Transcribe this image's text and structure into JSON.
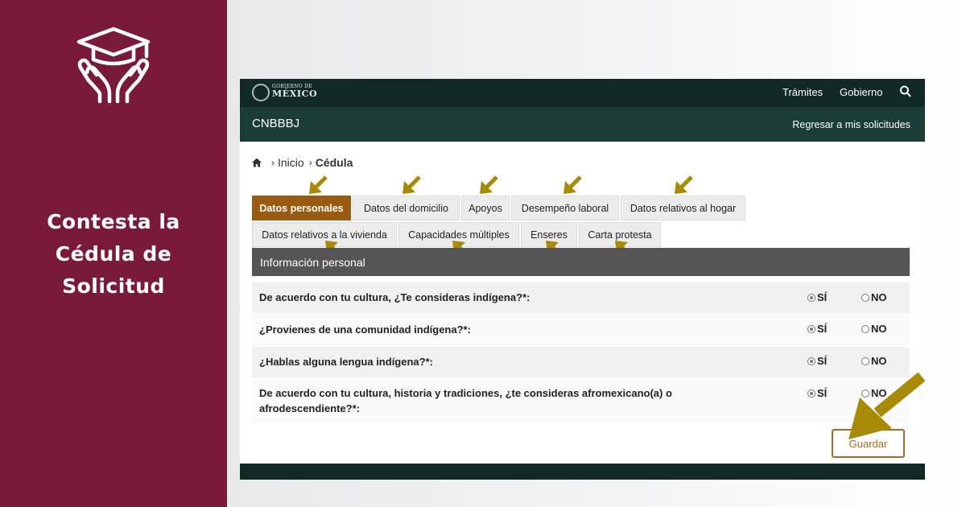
{
  "left_panel": {
    "icon": "graduation-cap-hands-icon",
    "title_lines": [
      "Contesta la",
      "Cédula de",
      "Solicitud"
    ]
  },
  "gov_bar": {
    "logo_small": "GOBIERNO DE",
    "logo_big": "MÉXICO",
    "links": [
      "Trámites",
      "Gobierno"
    ],
    "search_icon": "search-icon"
  },
  "app_bar": {
    "name": "CNBBBJ",
    "back_link": "Regresar a mis solicitudes"
  },
  "breadcrumb": {
    "home": "Inicio",
    "current": "Cédula"
  },
  "tabs_row1": [
    "Datos personales",
    "Datos del domicilio",
    "Apoyos",
    "Desempeño laboral",
    "Datos relativos al hogar"
  ],
  "tabs_row2": [
    "Datos relativos a la vivienda",
    "Capacidades múltiples",
    "Enseres",
    "Carta protesta"
  ],
  "active_tab": "Datos personales",
  "section": {
    "title": "Información personal"
  },
  "questions": [
    {
      "text": "De acuerdo con tu cultura, ¿Te consideras indígena?*:",
      "yes": "SÍ",
      "no": "NO",
      "selected": "SÍ"
    },
    {
      "text": "¿Provienes de una comunidad indígena?*:",
      "yes": "SÍ",
      "no": "NO",
      "selected": "SÍ"
    },
    {
      "text": "¿Hablas alguna lengua indígena?*:",
      "yes": "SÍ",
      "no": "NO",
      "selected": "SÍ"
    },
    {
      "text": "De acuerdo con tu cultura, historia y tradiciones, ¿te consideras afromexicano(a) o afrodescendiente?*:",
      "yes": "SÍ",
      "no": "NO",
      "selected": "SÍ"
    }
  ],
  "save_button": "Guardar",
  "colors": {
    "brand_panel": "#7a1a3b",
    "gov_dark": "#112a25",
    "app_green": "#1a3d37",
    "active_tab": "#9b5a12",
    "annotation_arrow": "#a68a08",
    "button_border": "#a36a2b"
  }
}
